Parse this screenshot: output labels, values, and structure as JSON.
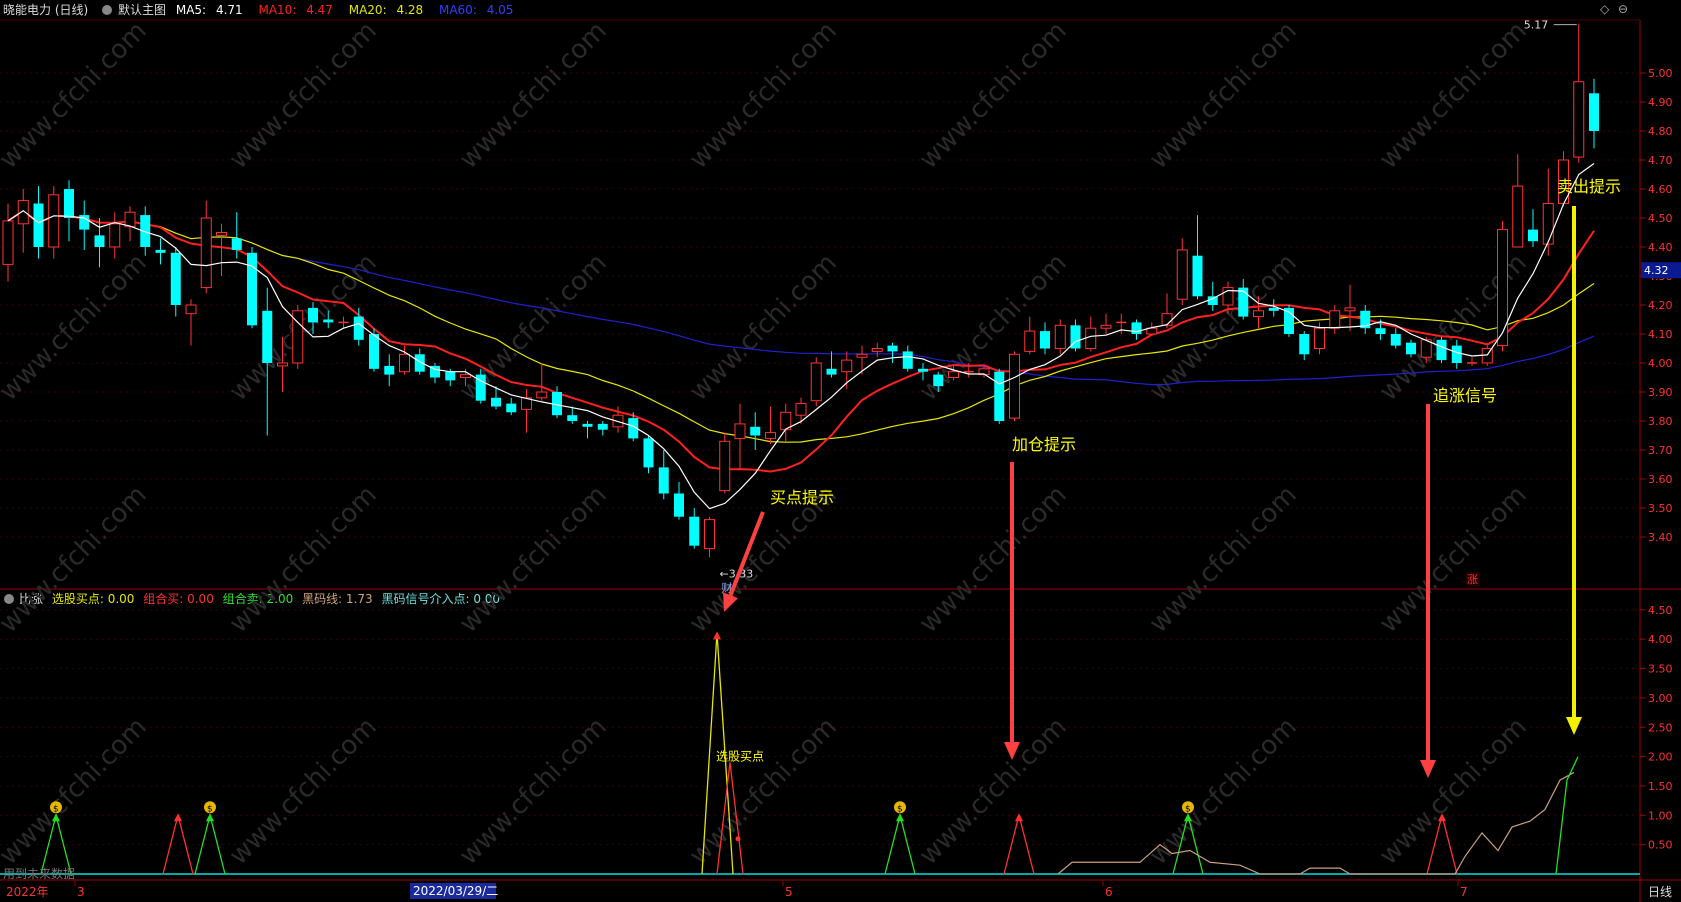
{
  "header": {
    "stock_name": "晓能电力 (日线)",
    "template": "默认主图",
    "ma5_label": "MA5:",
    "ma5_value": "4.71",
    "ma10_label": "MA10:",
    "ma10_value": "4.47",
    "ma20_label": "MA20:",
    "ma20_value": "4.28",
    "ma60_label": "MA60:",
    "ma60_value": "4.05"
  },
  "indicator_header": {
    "name": "比涨",
    "item1": "选股买点: 0.00",
    "item2": "组合买: 0.00",
    "item3": "组合卖: 2.00",
    "item4": "黑码线: 1.73",
    "item5": "黑码信号介入点: 0.00"
  },
  "main_axis": [
    "5.00",
    "4.90",
    "4.80",
    "4.70",
    "4.60",
    "4.50",
    "4.40",
    "4.30",
    "4.20",
    "4.10",
    "4.00",
    "3.90",
    "3.80",
    "3.70",
    "3.60",
    "3.50",
    "3.40"
  ],
  "sub_axis": [
    "4.50",
    "4.00",
    "3.50",
    "3.00",
    "2.50",
    "2.00",
    "1.50",
    "1.00",
    "0.50"
  ],
  "current_price": "4.32",
  "high_label": "5.17",
  "low_label": "3.33",
  "low_marker": "财",
  "limit_marker": "涨",
  "annotations": {
    "buy": "买点提示",
    "add": "加仓提示",
    "chase": "追涨信号",
    "sell": "卖出提示",
    "pick": "选股买点"
  },
  "date_axis": {
    "year": "2022年",
    "m3": "3",
    "selected": "2022/03/29/二",
    "m5": "5",
    "m6": "6",
    "m7": "7",
    "period": "日线"
  },
  "footer_text": "用到未来数据",
  "watermark": "www.cfchi.com",
  "colors": {
    "up": "#ff3232",
    "down": "#00ffff",
    "ma5": "#ffffff",
    "ma10": "#ff2020",
    "ma20": "#e6e600",
    "ma60": "#2020d0",
    "bg": "#000000",
    "axis": "#a00000"
  }
}
